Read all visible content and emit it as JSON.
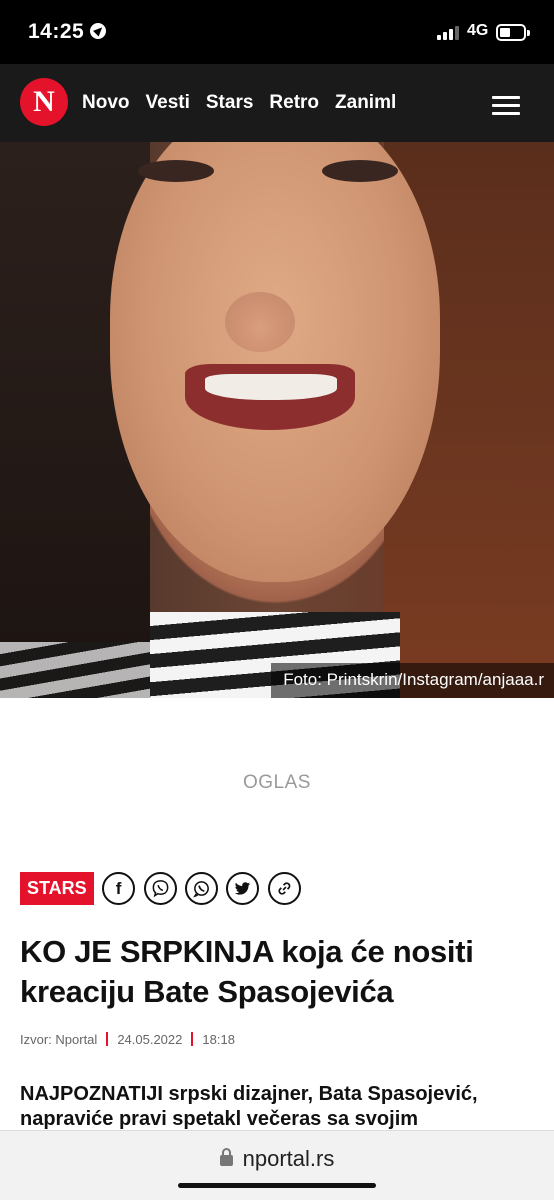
{
  "status_bar": {
    "time": "14:25",
    "network": "4G",
    "battery_level": 0.45
  },
  "navbar": {
    "logo_text": "N",
    "items": [
      "Novo",
      "Vesti",
      "Stars",
      "Retro",
      "Zaniml"
    ]
  },
  "hero": {
    "caption": "Foto: Printskrin/Instagram/anjaaa.r"
  },
  "ad": {
    "label": "OGLAS"
  },
  "article": {
    "category": "STARS",
    "share_icons": [
      "facebook-icon",
      "viber-icon",
      "whatsapp-icon",
      "twitter-icon",
      "link-icon"
    ],
    "share_glyphs": {
      "facebook": "f"
    },
    "headline": "KO JE SRPKINJA koja će nositi kreaciju Bate Spasojevića",
    "source": "Izvor: Nportal",
    "date": "24.05.2022",
    "time": "18:18",
    "lead": "NAJPOZNATIJI srpski dizajner, Bata Spasojević, napraviće pravi spetakl večeras sa svojim"
  },
  "browser": {
    "url": "nportal.rs"
  },
  "colors": {
    "brand_red": "#e4122a",
    "nav_bg": "#1a1a1a"
  }
}
